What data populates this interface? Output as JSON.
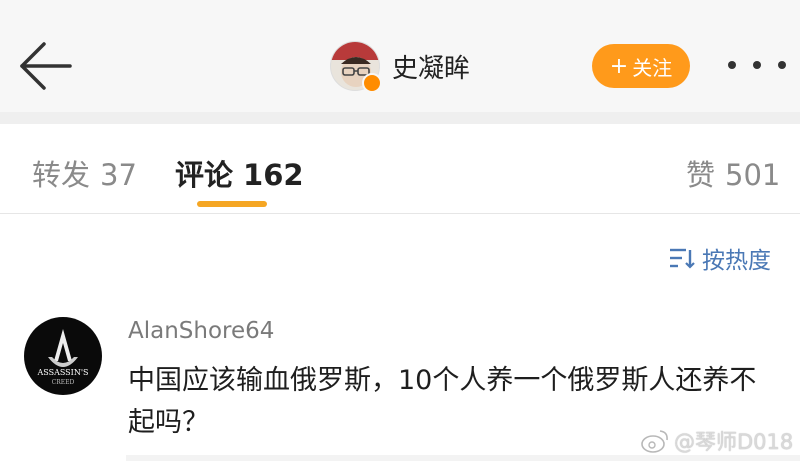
{
  "header": {
    "back_icon": "arrow-left-icon",
    "profile_name": "史凝眸",
    "follow_label": "关注",
    "follow_plus": "+",
    "more_icon": "more-dots-icon",
    "accent_color": "#ff9a1b"
  },
  "tabs": [
    {
      "label": "转发",
      "count": "37"
    },
    {
      "label": "评论",
      "count": "162",
      "active": true
    },
    {
      "label": "赞",
      "count": "501"
    }
  ],
  "sort": {
    "label": "按热度",
    "icon": "sort-icon"
  },
  "comment": {
    "username": "AlanShore64",
    "avatar_text_line1": "ASSASSIN'S",
    "avatar_text_line2": "CREED",
    "text": "中国应该输血俄罗斯，10个人养一个俄罗斯人还养不起吗？"
  },
  "watermark": {
    "text": "@琴师D018",
    "icon": "weibo-logo-icon"
  }
}
